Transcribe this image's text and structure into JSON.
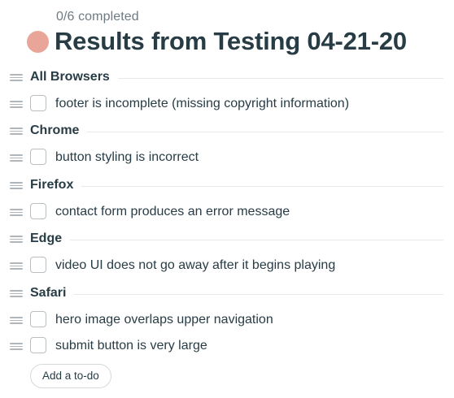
{
  "header": {
    "progress_text": "0/6 completed",
    "title": "Results from Testing 04-21-20",
    "status_color": "#e8a598"
  },
  "groups": [
    {
      "heading": "All Browsers",
      "todos": [
        {
          "text": "footer is incomplete (missing copyright information)",
          "completed": false
        }
      ]
    },
    {
      "heading": "Chrome",
      "todos": [
        {
          "text": "button styling is incorrect",
          "completed": false
        }
      ]
    },
    {
      "heading": "Firefox",
      "todos": [
        {
          "text": "contact form produces an error message",
          "completed": false
        }
      ]
    },
    {
      "heading": "Edge",
      "todos": [
        {
          "text": "video UI does not go away after it begins playing",
          "completed": false
        }
      ]
    },
    {
      "heading": "Safari",
      "todos": [
        {
          "text": "hero image overlaps upper navigation",
          "completed": false
        },
        {
          "text": "submit button is very large",
          "completed": false
        }
      ]
    }
  ],
  "actions": {
    "add_todo_label": "Add a to-do"
  },
  "icons": {
    "drag_handle": "drag-handle-icon",
    "status_dot": "status-dot-icon"
  }
}
